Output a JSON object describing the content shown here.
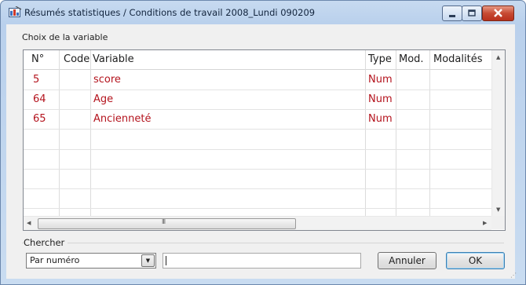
{
  "window": {
    "title": "Résumés statistiques / Conditions de travail 2008_Lundi 090209",
    "controls": [
      "minimize-icon",
      "maximize-icon",
      "close-icon"
    ]
  },
  "variable_chooser": {
    "label": "Choix de la variable",
    "columns": [
      "N°",
      "Code",
      "Variable",
      "Type",
      "Mod.",
      "Modalités"
    ],
    "rows": [
      {
        "num": "5",
        "code": "",
        "variable": "score",
        "type": "Num",
        "mod": "",
        "modalites": ""
      },
      {
        "num": "64",
        "code": "",
        "variable": "Age",
        "type": "Num",
        "mod": "",
        "modalites": ""
      },
      {
        "num": "65",
        "code": "",
        "variable": "Ancienneté",
        "type": "Num",
        "mod": "",
        "modalites": ""
      }
    ],
    "scrollbar_grip": "III"
  },
  "search": {
    "group_label": "Chercher",
    "mode_selected": "Par numéro",
    "query_value": ""
  },
  "buttons": {
    "cancel_label": "Annuler",
    "ok_label": "OK"
  },
  "colors": {
    "row_text": "#b4141e",
    "title_bar": "#b9d0ec",
    "close_button": "#c74a33"
  }
}
